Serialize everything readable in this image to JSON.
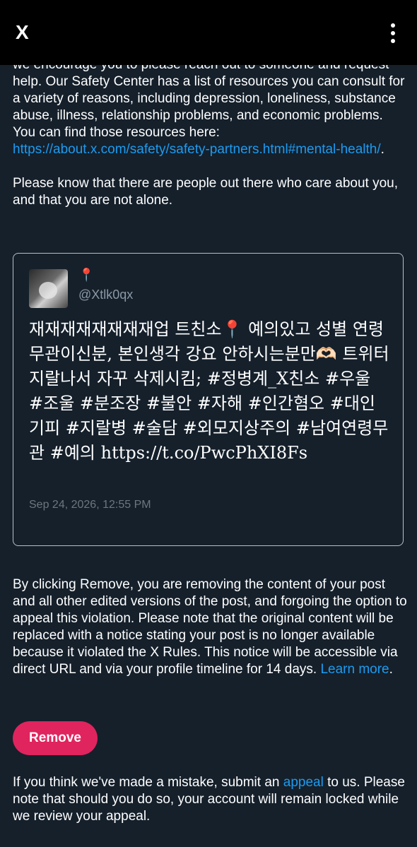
{
  "topbar": {
    "close_glyph": "X",
    "more_icon": "more-vertical-icon"
  },
  "intro": {
    "line_partial": "we encourage you to please reach out to someone and",
    "text_before_link": "request help. Our Safety Center has a list of resources you can consult for a variety of reasons, including depression, loneliness, substance abuse, illness, relationship problems, and economic problems. You can find those resources here:",
    "link": "https://about.x.com/safety/safety-partners.html#mental-health/",
    "after_link": "."
  },
  "reassurance": "Please know that there are people out there who care about you, and that you are not alone.",
  "post": {
    "display_name": "📍",
    "handle": "@Xtlk0qx",
    "text": "재재재재재재재재업 트친소📍 예의있고 성별 연령 무관이신분, 본인생각 강요 안하시는분만🫶🏻 트위터 지랄나서 자꾸 삭제시킴; #정병계_X친소 #우울 #조울 #분조장 #불안 #자해 #인간혐오 #대인기피 #지랄병 #술담 #외모지상주의 #남여연령무관 #예의 https://t.co/PwcPhXI8Fs",
    "timestamp": "Sep 24, 2026, 12:55 PM"
  },
  "notice": {
    "text": "By clicking Remove, you are removing the content of your post and all other edited versions of the post, and forgoing the option to appeal this violation. Please note that the original content will be replaced with a notice stating your post is no longer available because it violated the X Rules. This notice will be accessible via direct URL and via your profile timeline for 14 days.",
    "learn_more": "Learn more",
    "after_learn_more": "."
  },
  "remove_button": "Remove",
  "footer": {
    "before_link": "If you think we've made a mistake, submit an",
    "link": "appeal",
    "after_link": "to us. Please note that should you do so, your account will remain locked while we review your appeal."
  },
  "colors": {
    "background": "#15202b",
    "link": "#1d9bf0",
    "remove_button": "#e0245e"
  }
}
